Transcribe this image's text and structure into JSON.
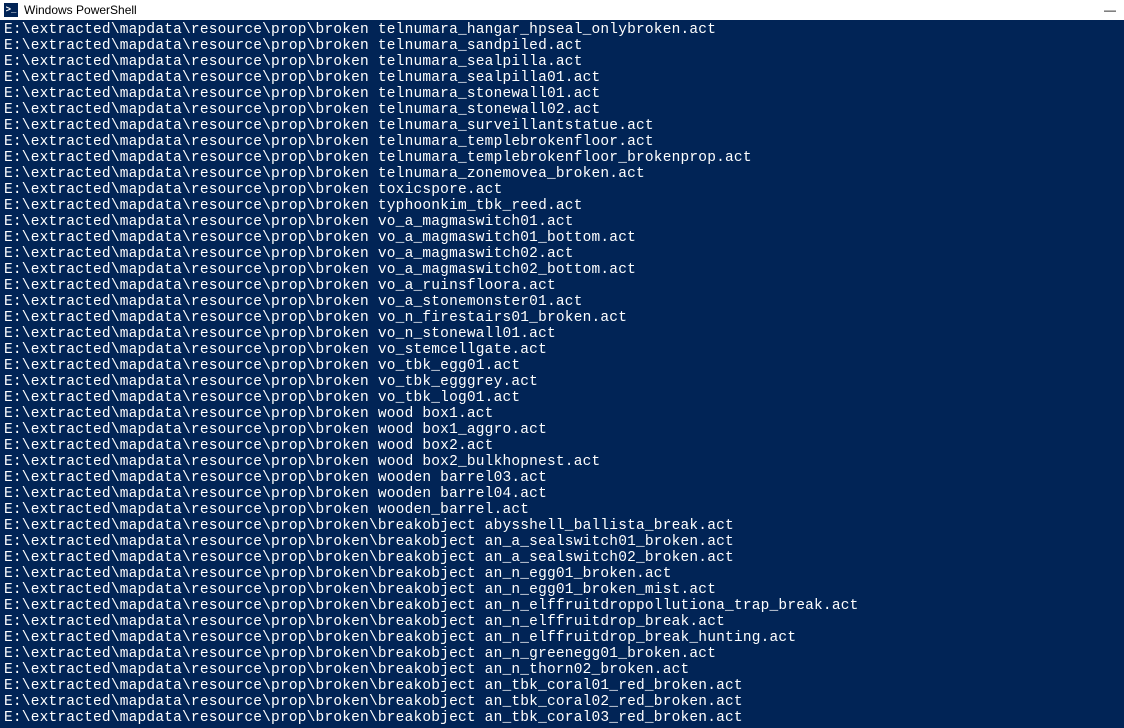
{
  "window": {
    "title": "Windows PowerShell"
  },
  "terminal": {
    "lines": [
      "E:\\extracted\\mapdata\\resource\\prop\\broken telnumara_hangar_hpseal_onlybroken.act",
      "E:\\extracted\\mapdata\\resource\\prop\\broken telnumara_sandpiled.act",
      "E:\\extracted\\mapdata\\resource\\prop\\broken telnumara_sealpilla.act",
      "E:\\extracted\\mapdata\\resource\\prop\\broken telnumara_sealpilla01.act",
      "E:\\extracted\\mapdata\\resource\\prop\\broken telnumara_stonewall01.act",
      "E:\\extracted\\mapdata\\resource\\prop\\broken telnumara_stonewall02.act",
      "E:\\extracted\\mapdata\\resource\\prop\\broken telnumara_surveillantstatue.act",
      "E:\\extracted\\mapdata\\resource\\prop\\broken telnumara_templebrokenfloor.act",
      "E:\\extracted\\mapdata\\resource\\prop\\broken telnumara_templebrokenfloor_brokenprop.act",
      "E:\\extracted\\mapdata\\resource\\prop\\broken telnumara_zonemovea_broken.act",
      "E:\\extracted\\mapdata\\resource\\prop\\broken toxicspore.act",
      "E:\\extracted\\mapdata\\resource\\prop\\broken typhoonkim_tbk_reed.act",
      "E:\\extracted\\mapdata\\resource\\prop\\broken vo_a_magmaswitch01.act",
      "E:\\extracted\\mapdata\\resource\\prop\\broken vo_a_magmaswitch01_bottom.act",
      "E:\\extracted\\mapdata\\resource\\prop\\broken vo_a_magmaswitch02.act",
      "E:\\extracted\\mapdata\\resource\\prop\\broken vo_a_magmaswitch02_bottom.act",
      "E:\\extracted\\mapdata\\resource\\prop\\broken vo_a_ruinsfloora.act",
      "E:\\extracted\\mapdata\\resource\\prop\\broken vo_a_stonemonster01.act",
      "E:\\extracted\\mapdata\\resource\\prop\\broken vo_n_firestairs01_broken.act",
      "E:\\extracted\\mapdata\\resource\\prop\\broken vo_n_stonewall01.act",
      "E:\\extracted\\mapdata\\resource\\prop\\broken vo_stemcellgate.act",
      "E:\\extracted\\mapdata\\resource\\prop\\broken vo_tbk_egg01.act",
      "E:\\extracted\\mapdata\\resource\\prop\\broken vo_tbk_egggrey.act",
      "E:\\extracted\\mapdata\\resource\\prop\\broken vo_tbk_log01.act",
      "E:\\extracted\\mapdata\\resource\\prop\\broken wood box1.act",
      "E:\\extracted\\mapdata\\resource\\prop\\broken wood box1_aggro.act",
      "E:\\extracted\\mapdata\\resource\\prop\\broken wood box2.act",
      "E:\\extracted\\mapdata\\resource\\prop\\broken wood box2_bulkhopnest.act",
      "E:\\extracted\\mapdata\\resource\\prop\\broken wooden barrel03.act",
      "E:\\extracted\\mapdata\\resource\\prop\\broken wooden barrel04.act",
      "E:\\extracted\\mapdata\\resource\\prop\\broken wooden_barrel.act",
      "E:\\extracted\\mapdata\\resource\\prop\\broken\\breakobject abysshell_ballista_break.act",
      "E:\\extracted\\mapdata\\resource\\prop\\broken\\breakobject an_a_sealswitch01_broken.act",
      "E:\\extracted\\mapdata\\resource\\prop\\broken\\breakobject an_a_sealswitch02_broken.act",
      "E:\\extracted\\mapdata\\resource\\prop\\broken\\breakobject an_n_egg01_broken.act",
      "E:\\extracted\\mapdata\\resource\\prop\\broken\\breakobject an_n_egg01_broken_mist.act",
      "E:\\extracted\\mapdata\\resource\\prop\\broken\\breakobject an_n_elffruitdroppollutiona_trap_break.act",
      "E:\\extracted\\mapdata\\resource\\prop\\broken\\breakobject an_n_elffruitdrop_break.act",
      "E:\\extracted\\mapdata\\resource\\prop\\broken\\breakobject an_n_elffruitdrop_break_hunting.act",
      "E:\\extracted\\mapdata\\resource\\prop\\broken\\breakobject an_n_greenegg01_broken.act",
      "E:\\extracted\\mapdata\\resource\\prop\\broken\\breakobject an_n_thorn02_broken.act",
      "E:\\extracted\\mapdata\\resource\\prop\\broken\\breakobject an_tbk_coral01_red_broken.act",
      "E:\\extracted\\mapdata\\resource\\prop\\broken\\breakobject an_tbk_coral02_red_broken.act",
      "E:\\extracted\\mapdata\\resource\\prop\\broken\\breakobject an_tbk_coral03_red_broken.act"
    ]
  }
}
